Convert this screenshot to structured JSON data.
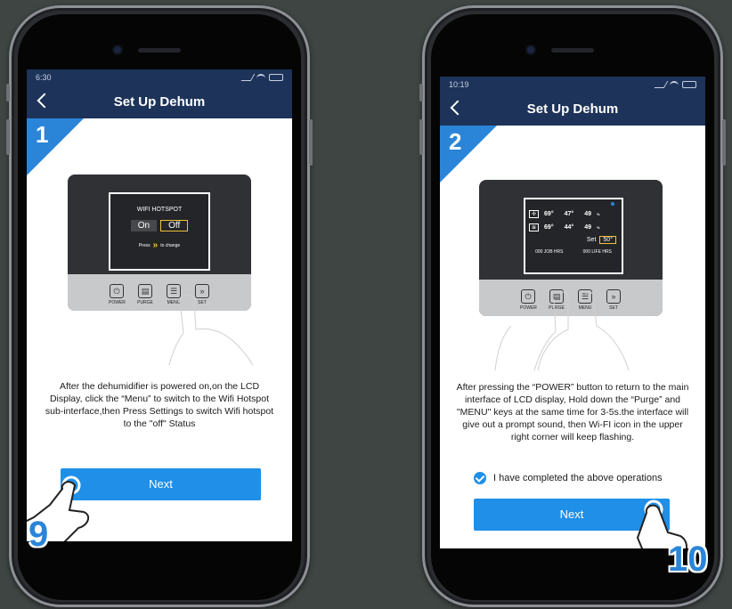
{
  "left": {
    "status_time": "6:30",
    "title": "Set Up Dehum",
    "step": "1",
    "lcd": {
      "heading": "WIFI HOTSPOT",
      "on_label": "On",
      "off_label": "Off",
      "press_label": "Press",
      "change_label": "to change"
    },
    "buttons": [
      "POWER",
      "PURGE",
      "MENU",
      "SET"
    ],
    "instruction": "After the dehumidifier is powered on,on the LCD Display, click the “Menu” to switch to the Wifi Hotspot sub-interface,then Press Settings to switch Wifi hotspot to the \"off\" Status",
    "next_label": "Next",
    "badge": "9"
  },
  "right": {
    "status_time": "10:19",
    "title": "Set Up Dehum",
    "step": "2",
    "lcd": {
      "row1": [
        "69°",
        "47°",
        "49"
      ],
      "row2": [
        "69°",
        "44°",
        "49"
      ],
      "unit": "%",
      "set_label": "Set",
      "set_value": "50°",
      "job_hrs": "000  JOB HRS",
      "life_hrs": "000  LIFE HRS"
    },
    "buttons": [
      "POWER",
      "PURGE",
      "MENU",
      "SET"
    ],
    "instruction": "After pressing the “POWER” button to return to the main interface of LCD display, Hold down the “Purge” and \"MENU\" keys at the same time for 3-5s.the interface will give out a prompt sound, then Wi-FI icon in the upper right corner will keep flashing.",
    "checkbox_label": "I have completed the above operations",
    "next_label": "Next",
    "badge": "10"
  },
  "colors": {
    "header": "#1d3359",
    "accent": "#2a85d8",
    "button": "#1f8fe8",
    "background": "#3e4543"
  }
}
